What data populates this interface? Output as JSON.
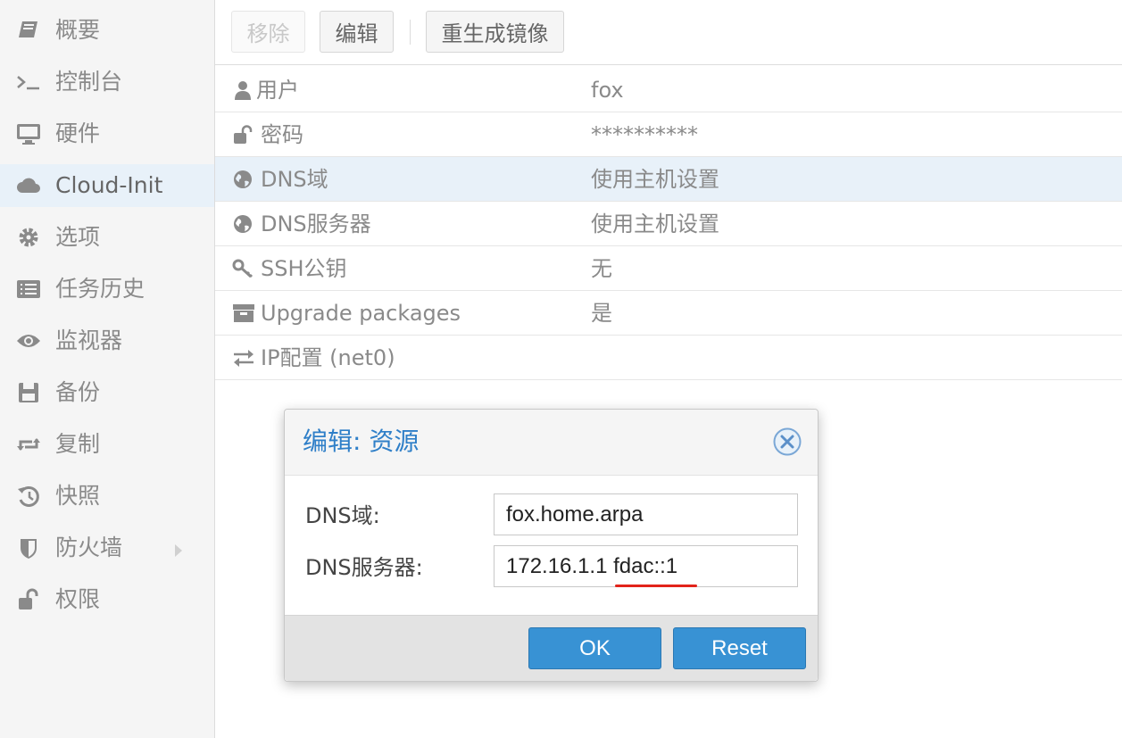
{
  "sidebar": {
    "items": [
      {
        "label": "概要",
        "icon": "book-icon"
      },
      {
        "label": "控制台",
        "icon": "terminal-icon"
      },
      {
        "label": "硬件",
        "icon": "desktop-icon"
      },
      {
        "label": "Cloud-Init",
        "icon": "cloud-icon",
        "selected": true
      },
      {
        "label": "选项",
        "icon": "gear-icon"
      },
      {
        "label": "任务历史",
        "icon": "list-icon"
      },
      {
        "label": "监视器",
        "icon": "eye-icon"
      },
      {
        "label": "备份",
        "icon": "floppy-icon"
      },
      {
        "label": "复制",
        "icon": "retweet-icon"
      },
      {
        "label": "快照",
        "icon": "history-icon"
      },
      {
        "label": "防火墙",
        "icon": "shield-icon"
      },
      {
        "label": "权限",
        "icon": "unlock-icon"
      }
    ]
  },
  "toolbar": {
    "remove_label": "移除",
    "edit_label": "编辑",
    "regenerate_label": "重生成镜像"
  },
  "grid": {
    "rows": [
      {
        "name": "用户",
        "value": "fox",
        "icon": "user-icon"
      },
      {
        "name": "密码",
        "value": "**********",
        "icon": "unlock-icon"
      },
      {
        "name": "DNS域",
        "value": "使用主机设置",
        "icon": "globe-icon"
      },
      {
        "name": "DNS服务器",
        "value": "使用主机设置",
        "icon": "globe-icon"
      },
      {
        "name": "SSH公钥",
        "value": "无",
        "icon": "key-icon"
      },
      {
        "name": "Upgrade packages",
        "value": "是",
        "icon": "archive-icon"
      },
      {
        "name": "IP配置 (net0)",
        "value": "",
        "icon": "exchange-icon"
      }
    ]
  },
  "dialog": {
    "title": "编辑: 资源",
    "fields": [
      {
        "label": "DNS域:",
        "value": "fox.home.arpa"
      },
      {
        "label": "DNS服务器:",
        "value": "172.16.1.1 fdac::1"
      }
    ],
    "ok_label": "OK",
    "reset_label": "Reset"
  },
  "colors": {
    "accent": "#3892d4",
    "title": "#2f7fc8",
    "selected_row": "#e8f1f9",
    "underline_annotation": "#e2231a"
  }
}
